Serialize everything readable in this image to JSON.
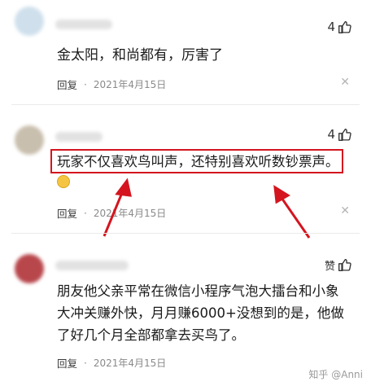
{
  "comments": [
    {
      "likes": "4",
      "text": "金太阳，和尚都有，厉害了",
      "reply_label": "回复",
      "date": "2021年4月15日"
    },
    {
      "likes": "4",
      "text": "玩家不仅喜欢鸟叫声，还特别喜欢听数钞票声。",
      "reply_label": "回复",
      "date": "2021年4月15日"
    },
    {
      "likes": "赞",
      "text_lines": [
        "朋友他父亲平常在微信小程序气泡大擂台和小象",
        "大冲关赚外快，月月赚6000+没想到的是，他做",
        "了好几个月全部都拿去买鸟了。"
      ],
      "reply_label": "回复",
      "date": "2021年4月15日"
    }
  ],
  "separator": "·",
  "close_glyph": "✕",
  "watermark": "知乎 @Anni",
  "colors": {
    "highlight": "#d4151f",
    "arrow": "#d4151f"
  }
}
